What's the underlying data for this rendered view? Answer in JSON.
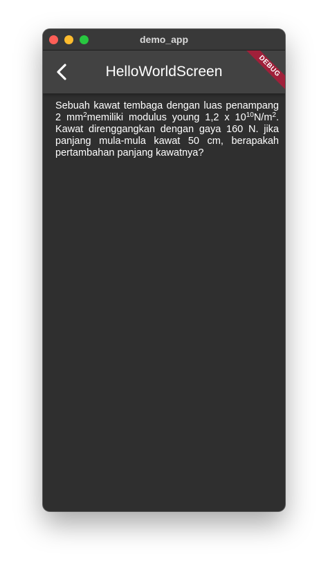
{
  "window": {
    "title": "demo_app"
  },
  "appbar": {
    "title": "HelloWorldScreen",
    "back_icon": "chevron-left-icon"
  },
  "debug_banner": {
    "label": "DEBUG"
  },
  "content": {
    "part1": "Sebuah kawat tembaga dengan luas penampang 2 mm",
    "sup1": "2",
    "part2": "memiliki modulus young 1,2 x 10",
    "sup2": "10",
    "part3": "N/m",
    "sup3": "2",
    "part4": ". Kawat direnggangkan dengan gaya 160 N. jika panjang mula-mula kawat 50 cm, berapakah pertambahan panjang kawatnya?"
  },
  "colors": {
    "background": "#2f2f2f",
    "appbar": "#424242",
    "titlebar": "#393939",
    "debug": "#a0203a"
  }
}
